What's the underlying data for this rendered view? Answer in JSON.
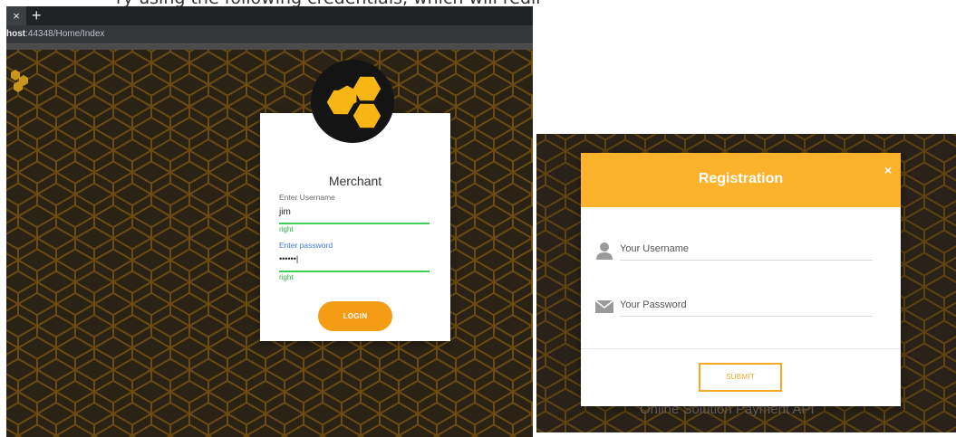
{
  "document": {
    "caption_fragment": "ry using the following credentials, which will redirect you"
  },
  "browser": {
    "tab_close": "×",
    "new_tab": "+",
    "url_host": "host",
    "url_path": ":44348/Home/Index"
  },
  "login": {
    "title": "Merchant",
    "username_label": "Enter Username",
    "username_value": "jim",
    "username_helper": "right",
    "password_label": "Enter password",
    "password_value": "••••••|",
    "password_helper": "right",
    "button_label": "LOGIN"
  },
  "registration": {
    "title": "Registration",
    "close": "×",
    "username_placeholder": "Your Username",
    "password_placeholder": "Your Password",
    "submit_label": "SUBMIT",
    "footer_text": "Online Solution Payment API"
  },
  "colors": {
    "honey_dark": "#2a2218",
    "hex_stroke": "#6b4b12",
    "accent_orange": "#f59c15",
    "header_yellow": "#fcb32b",
    "valid_green": "#3ecf5a"
  }
}
